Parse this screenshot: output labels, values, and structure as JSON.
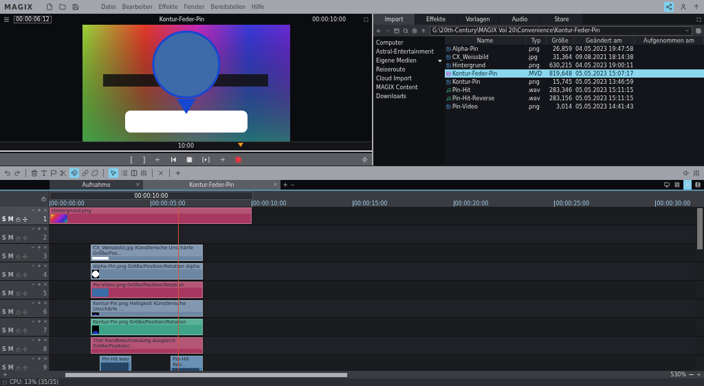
{
  "app": {
    "logo": "MAGIX"
  },
  "menu": [
    "Datei",
    "Bearbeiten",
    "Effekte",
    "Fenster",
    "Bereitstellen",
    "Hilfe"
  ],
  "preview": {
    "timecode": "00:00:06:12",
    "title": "Kontur-Feder-Pin",
    "duration": "00:00:10:00",
    "scrub_label": "10:00",
    "transport": [
      "[",
      "]"
    ]
  },
  "browser": {
    "tabs": [
      {
        "label": "Import",
        "selected": true
      },
      {
        "label": "Effekte",
        "selected": false
      },
      {
        "label": "Vorlagen",
        "selected": false
      },
      {
        "label": "Audio",
        "selected": false
      },
      {
        "label": "Store",
        "selected": false
      }
    ],
    "path": "G:\\20th-Century\\MAGIX Vol 20\\Convenience\\Kontur-Feder-Pin",
    "sidebar": [
      {
        "label": "Computer",
        "expandable": false
      },
      {
        "label": "Astral-Entertainment",
        "expandable": false
      },
      {
        "label": "Eigene Medien",
        "expandable": true
      },
      {
        "label": "Reiseroute",
        "expandable": false
      },
      {
        "label": "Cloud Import",
        "expandable": false
      },
      {
        "label": "MAGIX Content",
        "expandable": false
      },
      {
        "label": "Downloads",
        "expandable": false
      }
    ],
    "columns": [
      "Name",
      "Typ",
      "Größe",
      "Geändert am",
      "Aufgenommen am"
    ],
    "rows": [
      {
        "kind": "image",
        "name": "Alpha-Pin",
        "type": ".png",
        "size": "26,859",
        "modified": "04.05.2023 19:47:58",
        "selected": false
      },
      {
        "kind": "image",
        "name": "CX_Weissbild",
        "type": ".jpg",
        "size": "31,364",
        "modified": "09.08.2021 18:14:38",
        "selected": false
      },
      {
        "kind": "image",
        "name": "Hintergrund",
        "type": ".png",
        "size": "630,215",
        "modified": "04.05.2023 19:00:11",
        "selected": false
      },
      {
        "kind": "project",
        "name": "Kontur-Feder-Pin",
        "type": ".MVD",
        "size": "819,648",
        "modified": "05.05.2023 15:07:17",
        "selected": true
      },
      {
        "kind": "image",
        "name": "Kontur-Pin",
        "type": ".png",
        "size": "15,745",
        "modified": "05.05.2023 13:46:59",
        "selected": false
      },
      {
        "kind": "audio",
        "name": "Pin-Hit",
        "type": ".wav",
        "size": "283,346",
        "modified": "05.05.2023 15:11:15",
        "selected": false
      },
      {
        "kind": "audio",
        "name": "Pin-Hit-Reverse",
        "type": ".wav",
        "size": "283,156",
        "modified": "05.05.2023 15:11:15",
        "selected": false
      },
      {
        "kind": "image",
        "name": "Pin-Video",
        "type": ".png",
        "size": "3,014",
        "modified": "05.05.2023 14:41:43",
        "selected": false
      }
    ]
  },
  "toolbar": {
    "magnet_on": true,
    "pointer_on": true
  },
  "timeline": {
    "tabs": [
      {
        "label": "Aufnahme",
        "selected": false
      },
      {
        "label": "Kontur-Feder-Pin",
        "selected": true
      }
    ],
    "range_label": "00:00:10:00",
    "ruler": [
      "00:00:00:00",
      "00:00:05:00",
      "00:00:10:00",
      "00:00:15:00",
      "00:00:20:00",
      "00:00:25:00",
      "00:00:30:00"
    ],
    "view_modes": [
      {
        "selected": false
      },
      {
        "selected": false
      },
      {
        "selected": true
      },
      {
        "selected": false
      }
    ],
    "tracks": [
      {
        "number": "1",
        "selected": true,
        "buttons": [
          "S",
          "M"
        ],
        "clips": [
          {
            "title": "Hintergrund.png",
            "color": "#a8385f",
            "kind": "gradient"
          }
        ]
      },
      {
        "number": "2",
        "selected": false,
        "buttons": [
          "S",
          "M"
        ]
      },
      {
        "number": "3",
        "selected": false,
        "buttons": [
          "S",
          "M"
        ],
        "clips": [
          {
            "title": "CX_Weissbild.jpg  Künstlerische Unschärfe  Größe/Pos...",
            "color": "#6d87a3",
            "kind": "white"
          }
        ]
      },
      {
        "number": "4",
        "selected": false,
        "buttons": [
          "S",
          "M"
        ],
        "clips": [
          {
            "title": "Alpha-Pin.png  Größe/Position/Rotation  Alpha",
            "color": "#6d87a3",
            "kind": "circle"
          }
        ]
      },
      {
        "number": "5",
        "selected": false,
        "buttons": [
          "S",
          "M"
        ],
        "clips": [
          {
            "title": "Pin-Video.png  Größe/Position/Rotation",
            "color": "#a8385f",
            "kind": "video"
          }
        ]
      },
      {
        "number": "6",
        "selected": false,
        "buttons": [
          "S",
          "M"
        ],
        "clips": [
          {
            "title": "Kontur-Pin.png  Helligkeit  Künstlerische Unschärfe ...",
            "color": "#6d87a3",
            "kind": "pin"
          }
        ]
      },
      {
        "number": "7",
        "selected": false,
        "buttons": [
          "S",
          "M"
        ],
        "clips": [
          {
            "title": "Kontur-Pin.png  Größe/Position/Rotation",
            "color": "#3fa487",
            "kind": "pin"
          }
        ]
      },
      {
        "number": "8",
        "selected": false,
        "buttons": [
          "S",
          "M"
        ],
        "clips": [
          {
            "title": "Titel  Randbeschneidung Ausgleich  Größe/Position/...",
            "color": "#a8385f",
            "kind": "plain"
          }
        ]
      },
      {
        "number": "9",
        "selected": false,
        "buttons": [
          "S",
          "M"
        ],
        "clips": [
          {
            "title": "Pin-Hit.wav",
            "color": "#4f7ea6",
            "kind": "audio"
          },
          {
            "title": "Pin-Hit-Rev...",
            "color": "#4f7ea6",
            "kind": "audio"
          }
        ]
      }
    ],
    "zoom": "530%"
  },
  "status": "CPU: 13% (35/35)"
}
